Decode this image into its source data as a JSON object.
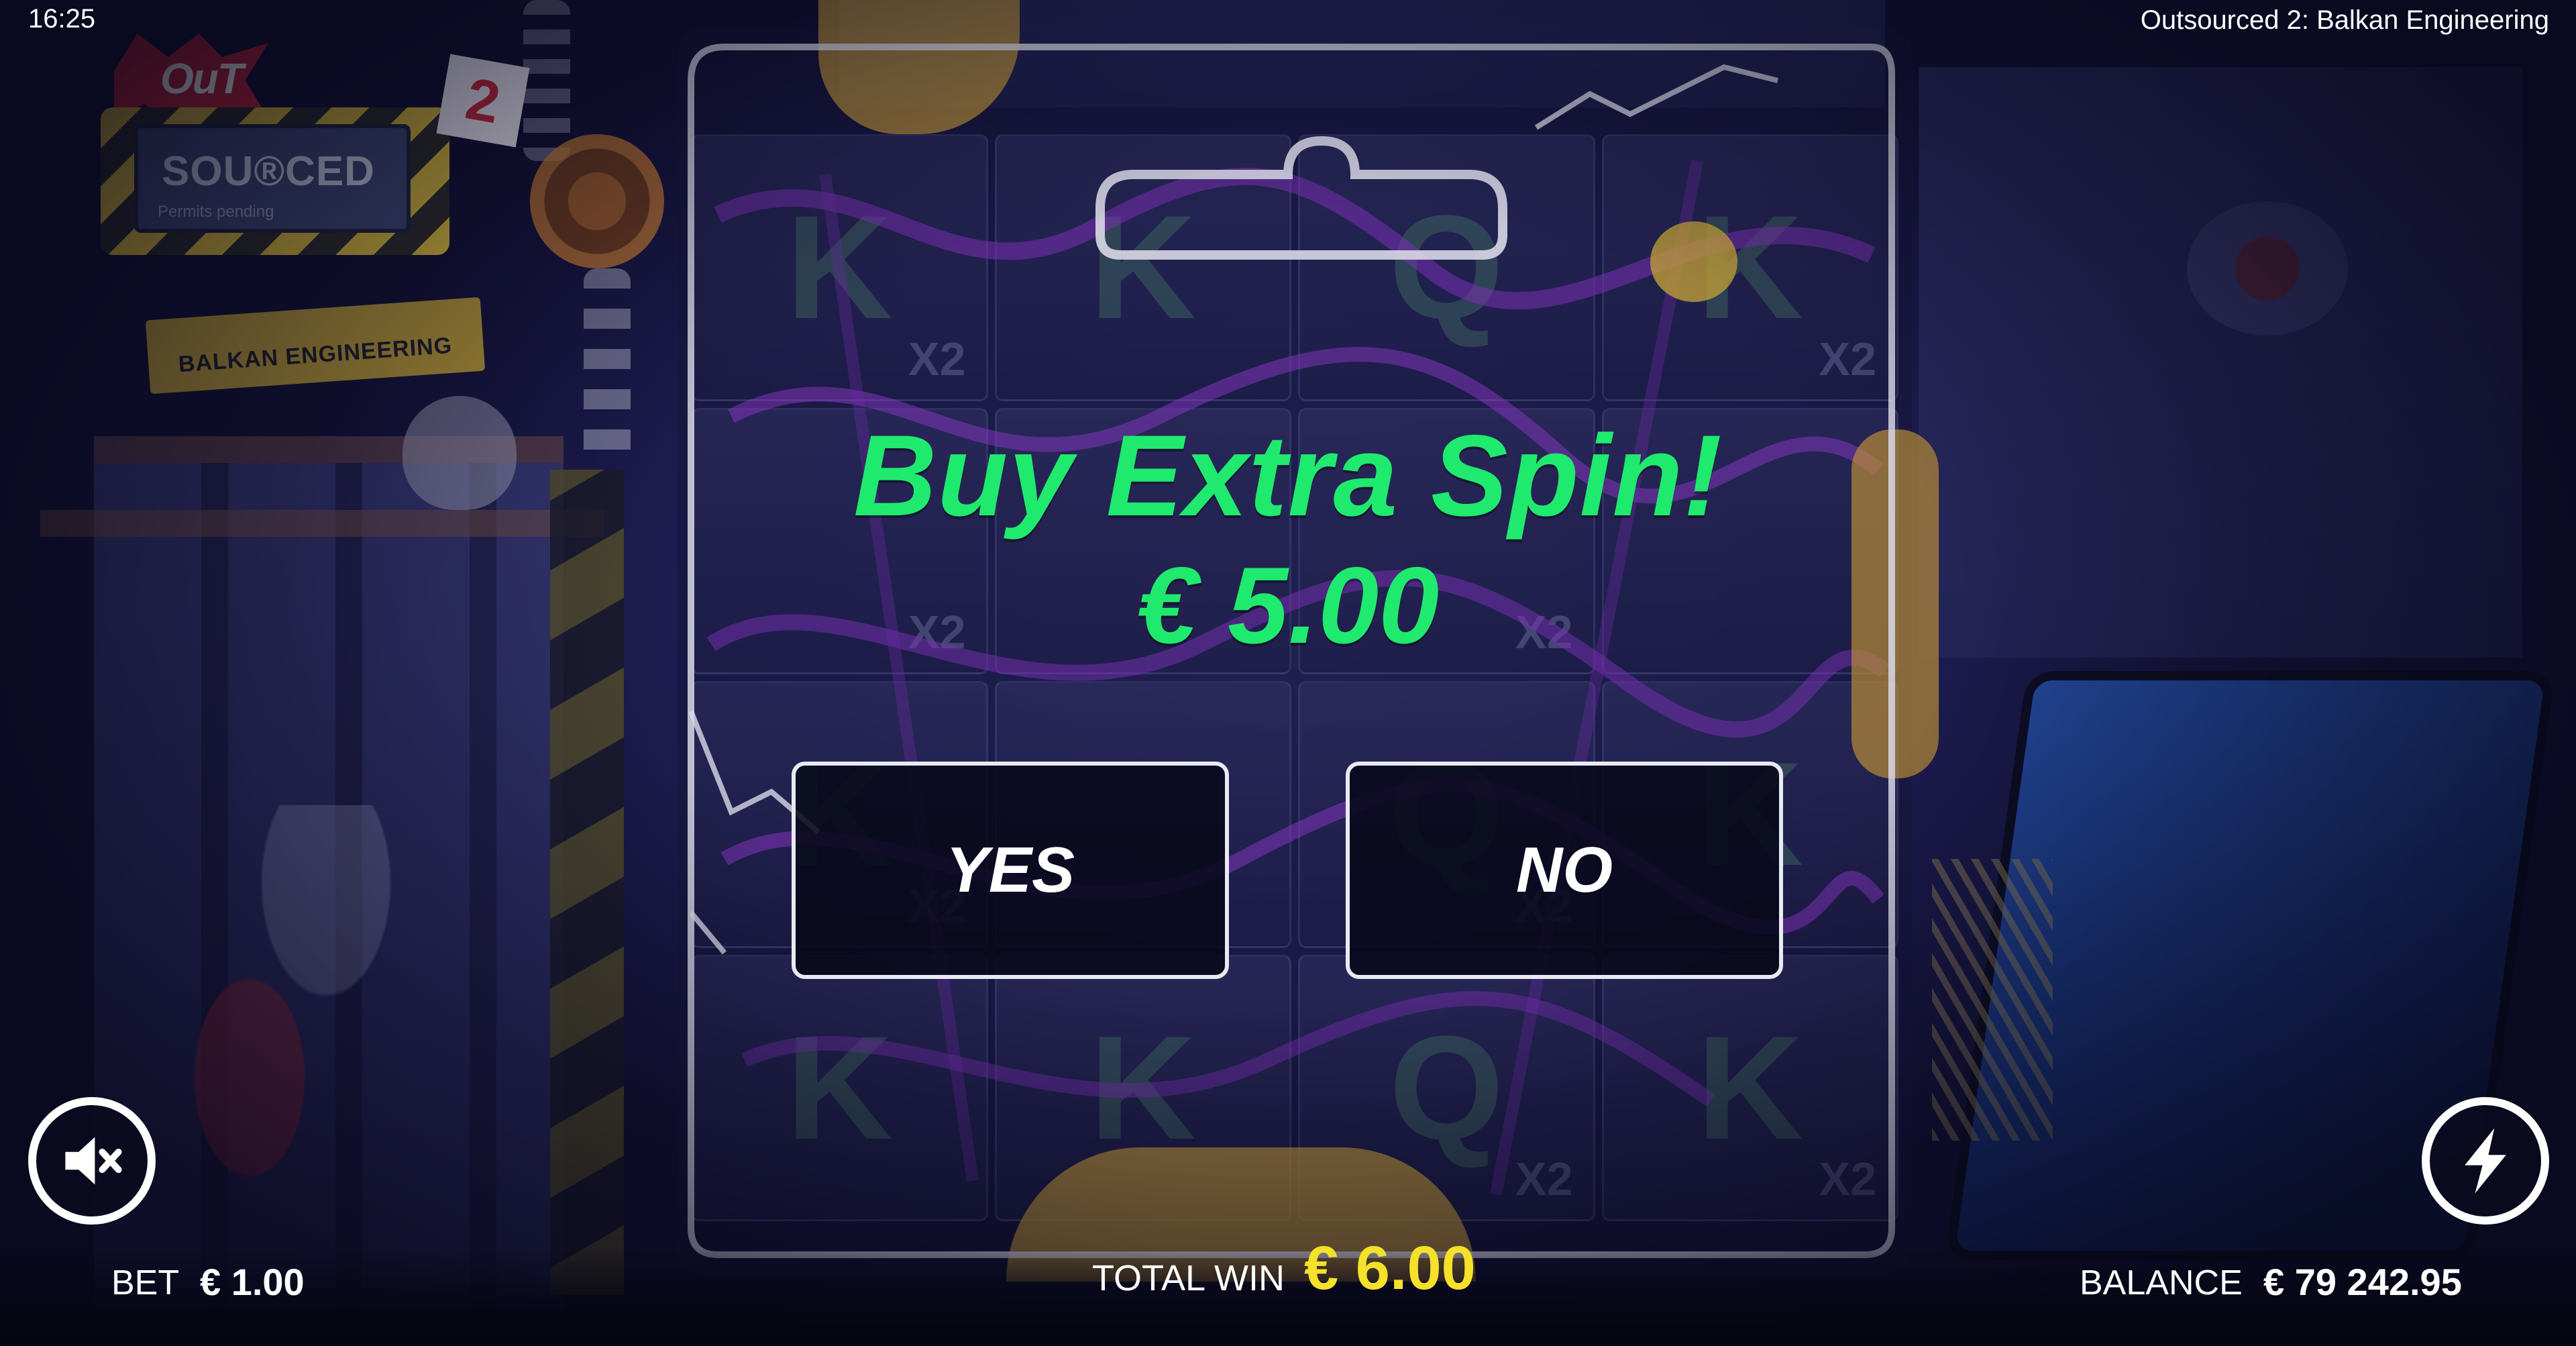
{
  "status_bar": {
    "clock": "16:25",
    "game_title": "Outsourced 2: Balkan Engineering"
  },
  "logo": {
    "out": "OuT",
    "sourced": "SOU®CED",
    "number": "2",
    "permits": "Permits pending",
    "subtitle": "BALKAN ENGINEERING"
  },
  "reels": {
    "symbols": [
      {
        "letter": "K",
        "mult": "X2"
      },
      {
        "letter": "K",
        "mult": ""
      },
      {
        "letter": "Q",
        "mult": ""
      },
      {
        "letter": "K",
        "mult": "X2"
      },
      {
        "letter": "",
        "mult": "X2"
      },
      {
        "letter": "",
        "mult": ""
      },
      {
        "letter": "",
        "mult": "X2"
      },
      {
        "letter": "",
        "mult": ""
      },
      {
        "letter": "K",
        "mult": "X2"
      },
      {
        "letter": "",
        "mult": ""
      },
      {
        "letter": "Q",
        "mult": "X2"
      },
      {
        "letter": "K",
        "mult": ""
      },
      {
        "letter": "K",
        "mult": ""
      },
      {
        "letter": "K",
        "mult": ""
      },
      {
        "letter": "Q",
        "mult": "X2"
      },
      {
        "letter": "K",
        "mult": "X2"
      }
    ]
  },
  "modal": {
    "title": "Buy Extra Spin!",
    "price": "€ 5.00",
    "yes_label": "YES",
    "no_label": "NO"
  },
  "hud": {
    "bet_label": "BET",
    "bet_value": "€ 1.00",
    "total_win_label": "TOTAL WIN",
    "total_win_value": "€ 6.00",
    "balance_label": "BALANCE",
    "balance_value": "€ 79 242.95"
  },
  "icons": {
    "sound": "speaker-muted-icon",
    "turbo": "lightning-icon"
  },
  "colors": {
    "accent_green": "#1fea6e",
    "win_yellow": "#f5e12a",
    "button_border": "#e9e9f3"
  }
}
